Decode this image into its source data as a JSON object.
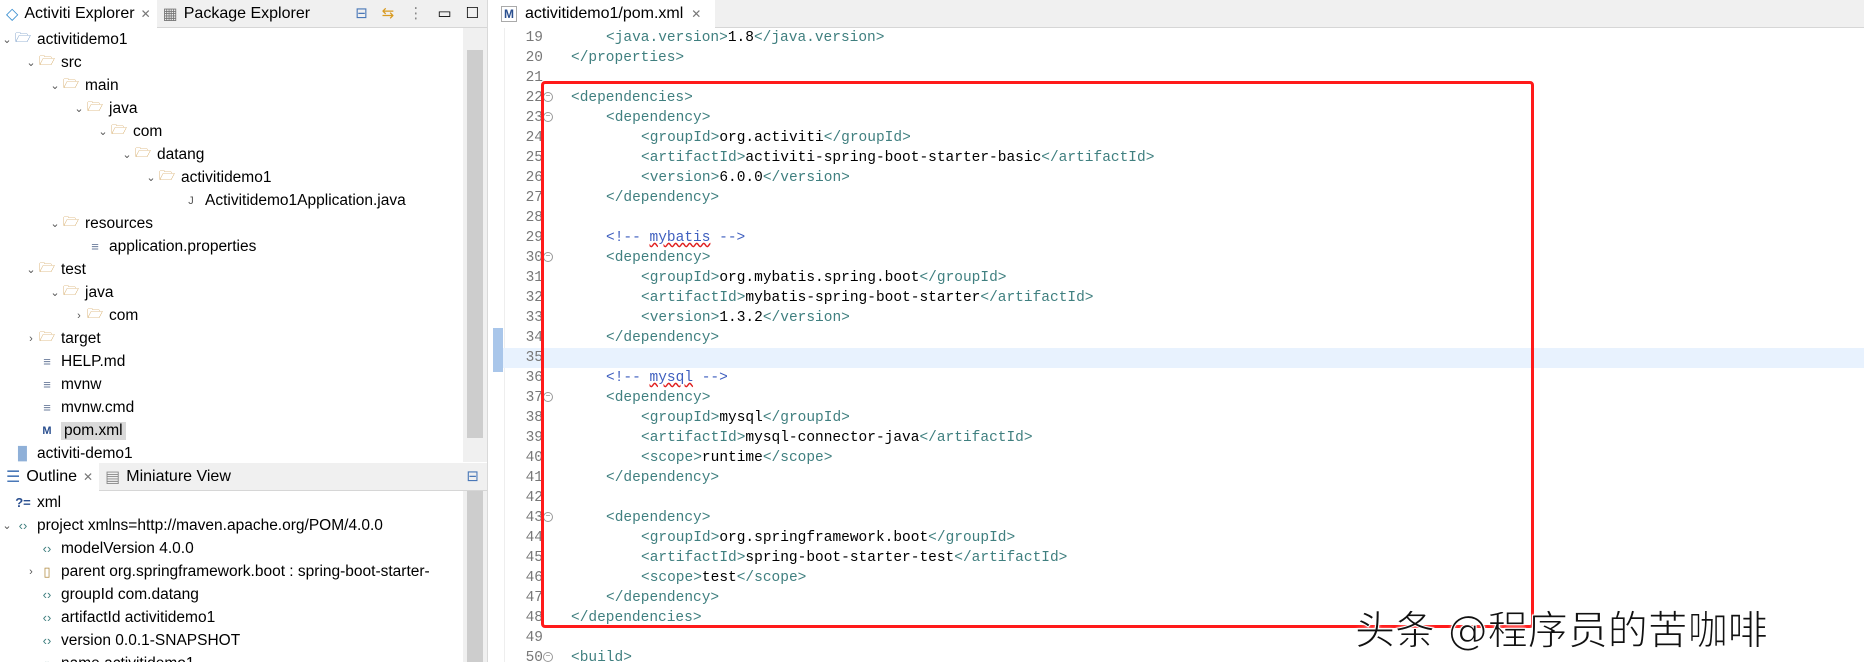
{
  "explorer": {
    "tabs": [
      {
        "label": "Activiti Explorer",
        "active": true
      },
      {
        "label": "Package Explorer",
        "active": false
      }
    ],
    "tree": [
      {
        "label": "activitidemo1",
        "depth": 0,
        "chevron": "open",
        "icon": "maven-project-icon"
      },
      {
        "label": "src",
        "depth": 1,
        "chevron": "open",
        "icon": "folder-icon"
      },
      {
        "label": "main",
        "depth": 2,
        "chevron": "open",
        "icon": "folder-icon"
      },
      {
        "label": "java",
        "depth": 3,
        "chevron": "open",
        "icon": "folder-icon"
      },
      {
        "label": "com",
        "depth": 4,
        "chevron": "open",
        "icon": "folder-icon"
      },
      {
        "label": "datang",
        "depth": 5,
        "chevron": "open",
        "icon": "folder-icon"
      },
      {
        "label": "activitidemo1",
        "depth": 6,
        "chevron": "open",
        "icon": "folder-icon"
      },
      {
        "label": "Activitidemo1Application.java",
        "depth": 7,
        "chevron": "none",
        "icon": "java-file-icon"
      },
      {
        "label": "resources",
        "depth": 2,
        "chevron": "open",
        "icon": "folder-icon"
      },
      {
        "label": "application.properties",
        "depth": 3,
        "chevron": "none",
        "icon": "text-file-icon"
      },
      {
        "label": "test",
        "depth": 1,
        "chevron": "open",
        "icon": "folder-icon"
      },
      {
        "label": "java",
        "depth": 2,
        "chevron": "open",
        "icon": "folder-icon"
      },
      {
        "label": "com",
        "depth": 3,
        "chevron": "closed",
        "icon": "folder-icon"
      },
      {
        "label": "target",
        "depth": 0,
        "chevron": "closed",
        "icon": "folder-icon",
        "indent": 1
      },
      {
        "label": "HELP.md",
        "depth": 1,
        "chevron": "none",
        "icon": "text-file-icon"
      },
      {
        "label": "mvnw",
        "depth": 1,
        "chevron": "none",
        "icon": "text-file-icon"
      },
      {
        "label": "mvnw.cmd",
        "depth": 1,
        "chevron": "none",
        "icon": "text-file-icon"
      },
      {
        "label": "pom.xml",
        "depth": 1,
        "chevron": "none",
        "icon": "maven-file-icon",
        "selected": true
      },
      {
        "label": "activiti-demo1",
        "depth": 0,
        "chevron": "none",
        "icon": "project-icon"
      }
    ]
  },
  "outline": {
    "tabs": [
      {
        "label": "Outline",
        "active": true
      },
      {
        "label": "Miniature View",
        "active": false
      }
    ],
    "items": [
      {
        "label": "xml",
        "depth": 0,
        "chevron": "none",
        "icon": "?="
      },
      {
        "label": "project xmlns=http://maven.apache.org/POM/4.0.0",
        "depth": 0,
        "chevron": "open",
        "icon": "<>"
      },
      {
        "label": "modelVersion  4.0.0",
        "depth": 1,
        "chevron": "none",
        "icon": "<>"
      },
      {
        "label": "parent  org.springframework.boot : spring-boot-starter-",
        "depth": 1,
        "chevron": "closed",
        "icon": "jar"
      },
      {
        "label": "groupId  com.datang",
        "depth": 1,
        "chevron": "none",
        "icon": "<>"
      },
      {
        "label": "artifactId  activitidemo1",
        "depth": 1,
        "chevron": "none",
        "icon": "<>"
      },
      {
        "label": "version  0.0.1-SNAPSHOT",
        "depth": 1,
        "chevron": "none",
        "icon": "<>"
      },
      {
        "label": "name  activitidemo1",
        "depth": 1,
        "chevron": "none",
        "icon": "<>"
      }
    ]
  },
  "editor": {
    "tab_label": "activitidemo1/pom.xml",
    "current_line": 35,
    "lines": [
      {
        "n": "19",
        "indent": 2,
        "tokens": [
          [
            "t",
            "<java.version>"
          ],
          [
            "v",
            "1.8"
          ],
          [
            "t",
            "</java.version>"
          ]
        ]
      },
      {
        "n": "20",
        "indent": 1,
        "tokens": [
          [
            "t",
            "</properties>"
          ]
        ]
      },
      {
        "n": "21",
        "indent": 0,
        "tokens": []
      },
      {
        "n": "22",
        "indent": 1,
        "fold": true,
        "tokens": [
          [
            "t",
            "<dependencies>"
          ]
        ]
      },
      {
        "n": "23",
        "indent": 2,
        "fold": true,
        "tokens": [
          [
            "t",
            "<dependency>"
          ]
        ]
      },
      {
        "n": "24",
        "indent": 3,
        "tokens": [
          [
            "t",
            "<groupId>"
          ],
          [
            "v",
            "org.activiti"
          ],
          [
            "t",
            "</groupId>"
          ]
        ]
      },
      {
        "n": "25",
        "indent": 3,
        "tokens": [
          [
            "t",
            "<artifactId>"
          ],
          [
            "v",
            "activiti-spring-boot-starter-basic"
          ],
          [
            "t",
            "</artifactId>"
          ]
        ]
      },
      {
        "n": "26",
        "indent": 3,
        "tokens": [
          [
            "t",
            "<version>"
          ],
          [
            "v",
            "6.0.0"
          ],
          [
            "t",
            "</version>"
          ]
        ]
      },
      {
        "n": "27",
        "indent": 2,
        "tokens": [
          [
            "t",
            "</dependency>"
          ]
        ]
      },
      {
        "n": "28",
        "indent": 0,
        "tokens": []
      },
      {
        "n": "29",
        "indent": 2,
        "tokens": [
          [
            "c",
            "<!-- "
          ],
          [
            "c sq",
            "mybatis"
          ],
          [
            "c",
            " -->"
          ]
        ]
      },
      {
        "n": "30",
        "indent": 2,
        "fold": true,
        "tokens": [
          [
            "t",
            "<dependency>"
          ]
        ]
      },
      {
        "n": "31",
        "indent": 3,
        "tokens": [
          [
            "t",
            "<groupId>"
          ],
          [
            "v",
            "org.mybatis.spring.boot"
          ],
          [
            "t",
            "</groupId>"
          ]
        ]
      },
      {
        "n": "32",
        "indent": 3,
        "tokens": [
          [
            "t",
            "<artifactId>"
          ],
          [
            "v",
            "mybatis-spring-boot-starter"
          ],
          [
            "t",
            "</artifactId>"
          ]
        ]
      },
      {
        "n": "33",
        "indent": 3,
        "tokens": [
          [
            "t",
            "<version>"
          ],
          [
            "v",
            "1.3.2"
          ],
          [
            "t",
            "</version>"
          ]
        ]
      },
      {
        "n": "34",
        "indent": 2,
        "tokens": [
          [
            "t",
            "</dependency>"
          ]
        ]
      },
      {
        "n": "35",
        "indent": 0,
        "tokens": []
      },
      {
        "n": "36",
        "indent": 2,
        "tokens": [
          [
            "c",
            "<!-- "
          ],
          [
            "c sq",
            "mysql"
          ],
          [
            "c",
            " -->"
          ]
        ]
      },
      {
        "n": "37",
        "indent": 2,
        "fold": true,
        "tokens": [
          [
            "t",
            "<dependency>"
          ]
        ]
      },
      {
        "n": "38",
        "indent": 3,
        "tokens": [
          [
            "t",
            "<groupId>"
          ],
          [
            "v",
            "mysql"
          ],
          [
            "t",
            "</groupId>"
          ]
        ]
      },
      {
        "n": "39",
        "indent": 3,
        "tokens": [
          [
            "t",
            "<artifactId>"
          ],
          [
            "v",
            "mysql-connector-java"
          ],
          [
            "t",
            "</artifactId>"
          ]
        ]
      },
      {
        "n": "40",
        "indent": 3,
        "tokens": [
          [
            "t",
            "<scope>"
          ],
          [
            "v",
            "runtime"
          ],
          [
            "t",
            "</scope>"
          ]
        ]
      },
      {
        "n": "41",
        "indent": 2,
        "tokens": [
          [
            "t",
            "</dependency>"
          ]
        ]
      },
      {
        "n": "42",
        "indent": 0,
        "tokens": []
      },
      {
        "n": "43",
        "indent": 2,
        "fold": true,
        "tokens": [
          [
            "t",
            "<dependency>"
          ]
        ]
      },
      {
        "n": "44",
        "indent": 3,
        "tokens": [
          [
            "t",
            "<groupId>"
          ],
          [
            "v",
            "org.springframework.boot"
          ],
          [
            "t",
            "</groupId>"
          ]
        ]
      },
      {
        "n": "45",
        "indent": 3,
        "tokens": [
          [
            "t",
            "<artifactId>"
          ],
          [
            "v",
            "spring-boot-starter-test"
          ],
          [
            "t",
            "</artifactId>"
          ]
        ]
      },
      {
        "n": "46",
        "indent": 3,
        "tokens": [
          [
            "t",
            "<scope>"
          ],
          [
            "v",
            "test"
          ],
          [
            "t",
            "</scope>"
          ]
        ]
      },
      {
        "n": "47",
        "indent": 2,
        "tokens": [
          [
            "t",
            "</dependency>"
          ]
        ]
      },
      {
        "n": "48",
        "indent": 1,
        "tokens": [
          [
            "t",
            "</dependencies>"
          ]
        ]
      },
      {
        "n": "49",
        "indent": 0,
        "tokens": []
      },
      {
        "n": "50",
        "indent": 1,
        "fold": true,
        "tokens": [
          [
            "t",
            "<build>"
          ]
        ]
      }
    ]
  },
  "watermark": "头条 @程序员的苦咖啡",
  "colors": {
    "highlight_box": "#ff1a1a",
    "tag": "#3f7f7f",
    "comment": "#3f5fbf",
    "current_line": "#e8f2fe"
  }
}
